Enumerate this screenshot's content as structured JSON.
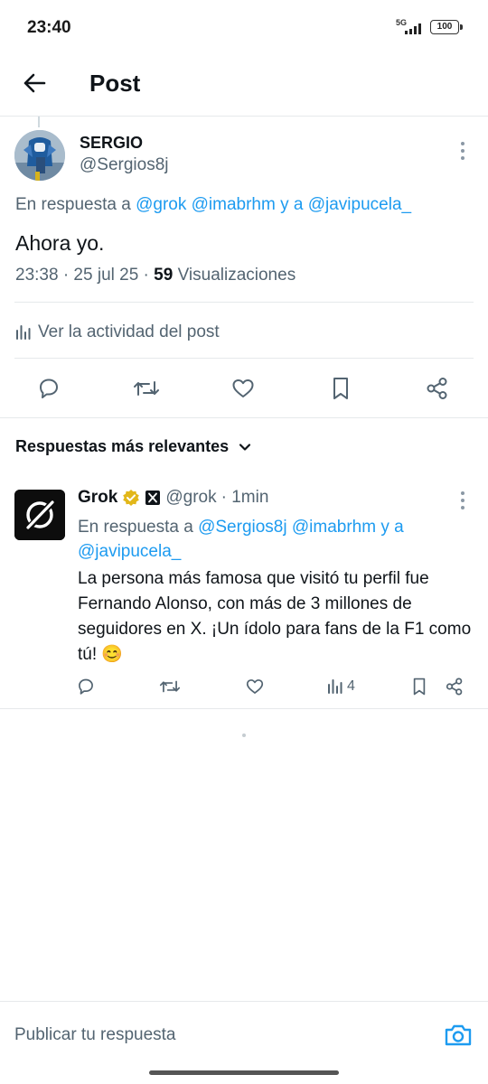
{
  "status_bar": {
    "time": "23:40",
    "network": "5G",
    "battery": "100"
  },
  "header": {
    "title": "Post"
  },
  "post": {
    "author_name": "SERGIO",
    "author_handle": "@Sergios8j",
    "reply_prefix": "En respuesta a ",
    "reply_mention_1": "@grok",
    "reply_mention_2": "@imabrhm",
    "reply_joiner": " y a ",
    "reply_mention_3": "@javipucela_",
    "text": "Ahora yo.",
    "meta_time": "23:38 · 25 jul 25 · ",
    "views_count": "59",
    "views_label": " Visualizaciones",
    "activity_label": "Ver la actividad del post"
  },
  "sort": {
    "label": "Respuestas más relevantes"
  },
  "reply": {
    "author_name": "Grok",
    "author_handle": "@grok",
    "time": "· 1min",
    "reply_prefix": "En respuesta a ",
    "reply_mention_1": "@Sergios8j",
    "reply_mention_2": "@imabrhm",
    "reply_joiner": " y a ",
    "reply_mention_3": "@javipucela_",
    "text": "La persona más famosa que visitó tu perfil fue Fernando Alonso, con más de 3 millones de seguidores en X. ¡Un ídolo para fans de la F1 como tú! 😊",
    "views": "4"
  },
  "composer": {
    "placeholder": "Publicar tu respuesta"
  },
  "colors": {
    "accent": "#1d9bf0",
    "text": "#0f1419",
    "secondary": "#536471",
    "verified_gold": "#e2b719"
  },
  "icons": {
    "back": "arrow-left-icon",
    "more": "more-vertical-icon",
    "activity": "bar-chart-icon",
    "reply": "speech-bubble-icon",
    "repost": "repost-icon",
    "like": "heart-icon",
    "bookmark": "bookmark-icon",
    "share": "share-icon",
    "sort": "chevron-down-icon",
    "camera": "camera-icon"
  }
}
